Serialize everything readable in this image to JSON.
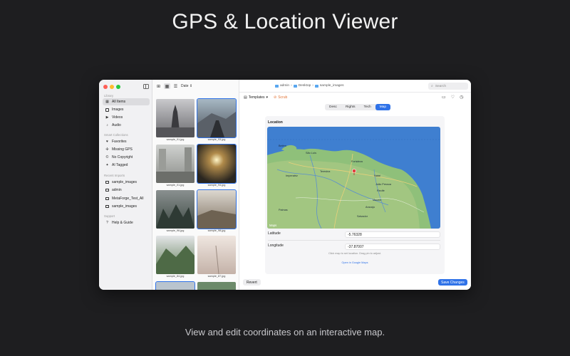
{
  "hero": {
    "title": "GPS & Location Viewer",
    "subtitle": "View and edit coordinates on an interactive map."
  },
  "sidebar": {
    "library_label": "Library",
    "library": [
      {
        "label": "All Items",
        "icon": "grid-icon"
      },
      {
        "label": "Images",
        "icon": "photo-icon"
      },
      {
        "label": "Videos",
        "icon": "video-icon"
      },
      {
        "label": "Audio",
        "icon": "music-note-icon"
      }
    ],
    "smart_label": "Smart Collections",
    "smart": [
      {
        "label": "Favorites",
        "icon": "heart-icon"
      },
      {
        "label": "Missing GPS",
        "icon": "location-icon"
      },
      {
        "label": "No Copyright",
        "icon": "copyright-icon"
      },
      {
        "label": "AI Tagged",
        "icon": "sparkle-icon"
      }
    ],
    "recent_label": "Recent Imports",
    "recent": [
      {
        "label": "sample_images",
        "icon": "folder-icon"
      },
      {
        "label": "admin",
        "icon": "folder-icon"
      },
      {
        "label": "MetaForge_Test_All",
        "icon": "folder-icon"
      },
      {
        "label": "sample_images",
        "icon": "folder-icon"
      }
    ],
    "support_label": "Support",
    "support": [
      {
        "label": "Help & Guide",
        "icon": "help-icon"
      }
    ]
  },
  "browser": {
    "sort_label": "Date",
    "thumbnails": [
      {
        "name": "sample_91.jpg",
        "selected": false
      },
      {
        "name": "sample_93.jpg",
        "selected": true
      },
      {
        "name": "sample_01.jpg",
        "selected": false
      },
      {
        "name": "sample_94.jpg",
        "selected": true
      },
      {
        "name": "sample_96.jpg",
        "selected": false
      },
      {
        "name": "sample_98.jpg",
        "selected": true
      },
      {
        "name": "sample_84.jpg",
        "selected": false
      },
      {
        "name": "sample_87.jpg",
        "selected": false
      }
    ]
  },
  "main": {
    "breadcrumb": [
      "admin",
      "Desktop",
      "sample_images"
    ],
    "search_placeholder": "Search",
    "templates_label": "Templates",
    "scrub_label": "Scrub",
    "tabs": [
      {
        "label": "Desc",
        "active": false
      },
      {
        "label": "Rights",
        "active": false
      },
      {
        "label": "Tech",
        "active": false
      },
      {
        "label": "Map",
        "active": true
      }
    ],
    "location_heading": "Location",
    "map_attribution": "Maps",
    "cities": [
      "Belém",
      "São Luís",
      "Fortaleza",
      "Teresina",
      "Natal",
      "João Pessoa",
      "Recife",
      "Imperatriz",
      "Maceió",
      "Aracaju",
      "Palmas",
      "Salvador"
    ],
    "latitude_label": "Latitude",
    "latitude_value": "-5.76328",
    "longitude_label": "Longitude",
    "longitude_value": "-37.87007",
    "hint": "Click map to set location. Drag pin to adjust.",
    "google_maps_link": "Open in Google Maps",
    "revert_label": "Revert",
    "save_label": "Save Changes"
  },
  "colors": {
    "accent": "#2f72e8",
    "scrub": "#e2763a",
    "ocean": "#3f7fd0",
    "land": "#8fc07a"
  }
}
